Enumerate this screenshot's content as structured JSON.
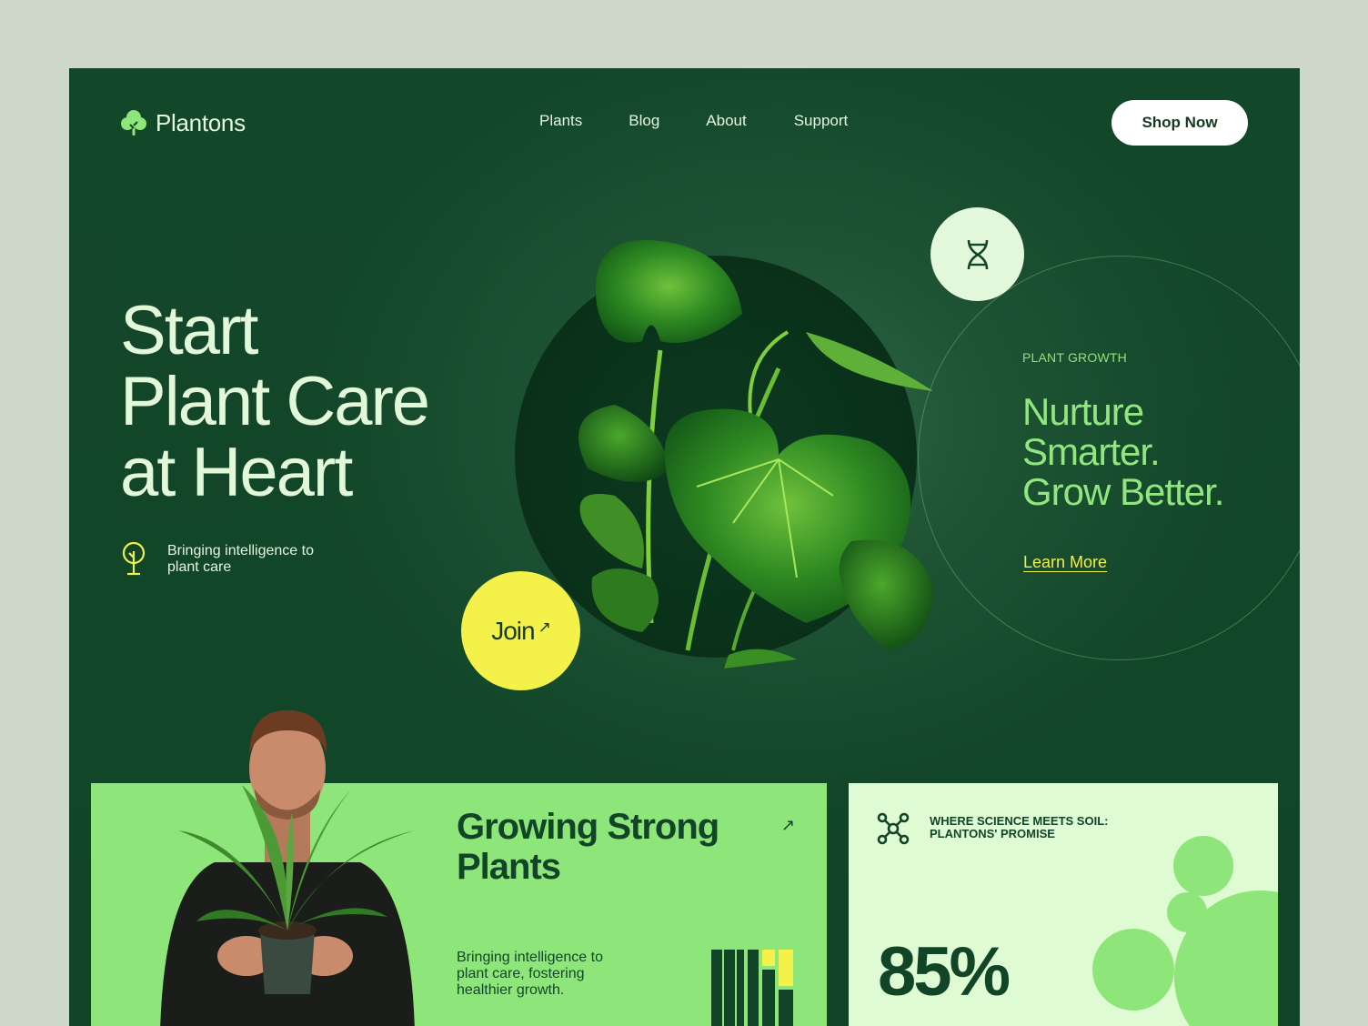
{
  "brand": {
    "name": "Plantons"
  },
  "nav": {
    "items": [
      "Plants",
      "Blog",
      "About",
      "Support"
    ]
  },
  "header": {
    "cta_label": "Shop Now"
  },
  "hero": {
    "title_lines": [
      "Start",
      "Plant Care",
      "at Heart"
    ],
    "subtitle": "Bringing intelligence to plant care",
    "join_label": "Join",
    "join_arrow": "↗"
  },
  "growth": {
    "kicker": "PLANT GROWTH",
    "title_lines": [
      "Nurture",
      "Smarter.",
      "Grow Better."
    ],
    "link_label": "Learn More"
  },
  "card_growing": {
    "title_lines": [
      "Growing Strong",
      "Plants"
    ],
    "arrow": "↗",
    "description": "Bringing intelligence to plant care, fostering healthier growth."
  },
  "card_science": {
    "title_lines": [
      "WHERE SCIENCE MEETS SOIL:",
      "PLANTONS' PROMISE"
    ],
    "stat": "85%"
  },
  "colors": {
    "dark_green": "#124528",
    "light_green": "#8ee67a",
    "pale_green": "#dffbd3",
    "yellow": "#f4f24a",
    "cream": "#e2f8d8"
  },
  "icons": [
    "tree-logo-icon",
    "sapling-icon",
    "dna-icon",
    "molecule-icon",
    "arrow-up-right-icon"
  ]
}
